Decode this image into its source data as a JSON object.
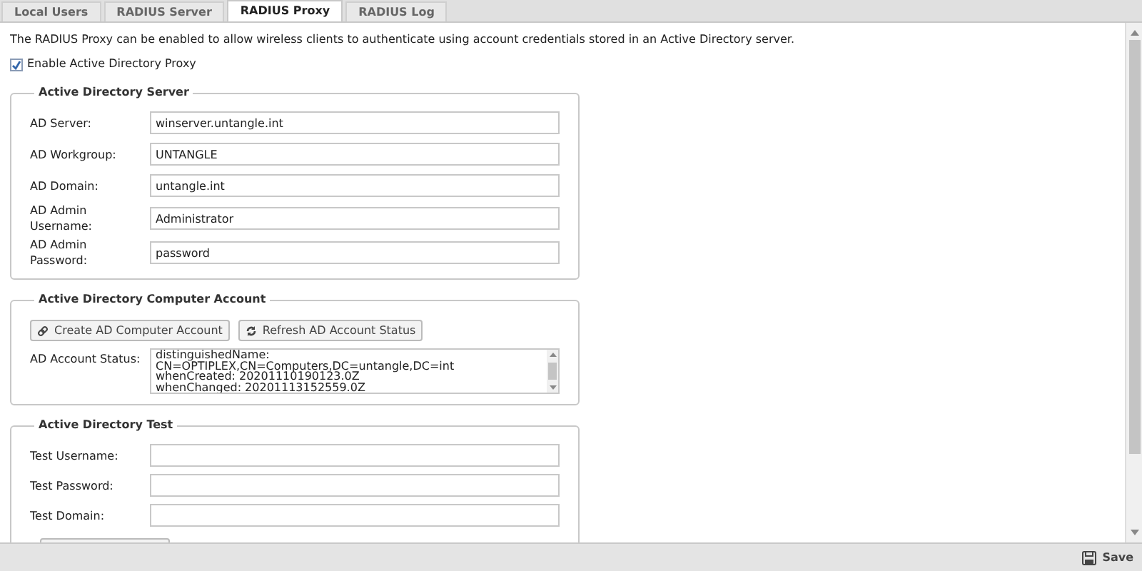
{
  "tabs": [
    {
      "label": "Local Users",
      "selected": false
    },
    {
      "label": "RADIUS Server",
      "selected": false
    },
    {
      "label": "RADIUS Proxy",
      "selected": true
    },
    {
      "label": "RADIUS Log",
      "selected": false
    }
  ],
  "description": "The RADIUS Proxy can be enabled to allow wireless clients to authenticate using account credentials stored in an Active Directory server.",
  "enable_proxy": {
    "label": "Enable Active Directory Proxy",
    "checked": true
  },
  "server_section": {
    "title": "Active Directory Server",
    "fields": [
      {
        "label": "AD Server:",
        "value": "winserver.untangle.int"
      },
      {
        "label": "AD Workgroup:",
        "value": "UNTANGLE"
      },
      {
        "label": "AD Domain:",
        "value": "untangle.int"
      },
      {
        "label": "AD Admin Username:",
        "value": "Administrator"
      },
      {
        "label": "AD Admin Password:",
        "value": "password"
      }
    ]
  },
  "account_section": {
    "title": "Active Directory Computer Account",
    "buttons": [
      {
        "label": "Create AD Computer Account",
        "kind": "link"
      },
      {
        "label": "Refresh AD Account Status",
        "kind": "refresh"
      }
    ],
    "status_label": "AD Account Status:",
    "status_lines": [
      "distinguishedName:",
      "CN=OPTIPLEX,CN=Computers,DC=untangle,DC=int",
      "whenCreated: 20201110190123.0Z",
      "whenChanged: 20201113152559.0Z"
    ]
  },
  "test_section": {
    "title": "Active Directory Test",
    "fields": [
      {
        "label": "Test Username:"
      },
      {
        "label": "Test Password:"
      },
      {
        "label": "Test Domain:"
      }
    ]
  },
  "footer": {
    "save_label": "Save"
  }
}
